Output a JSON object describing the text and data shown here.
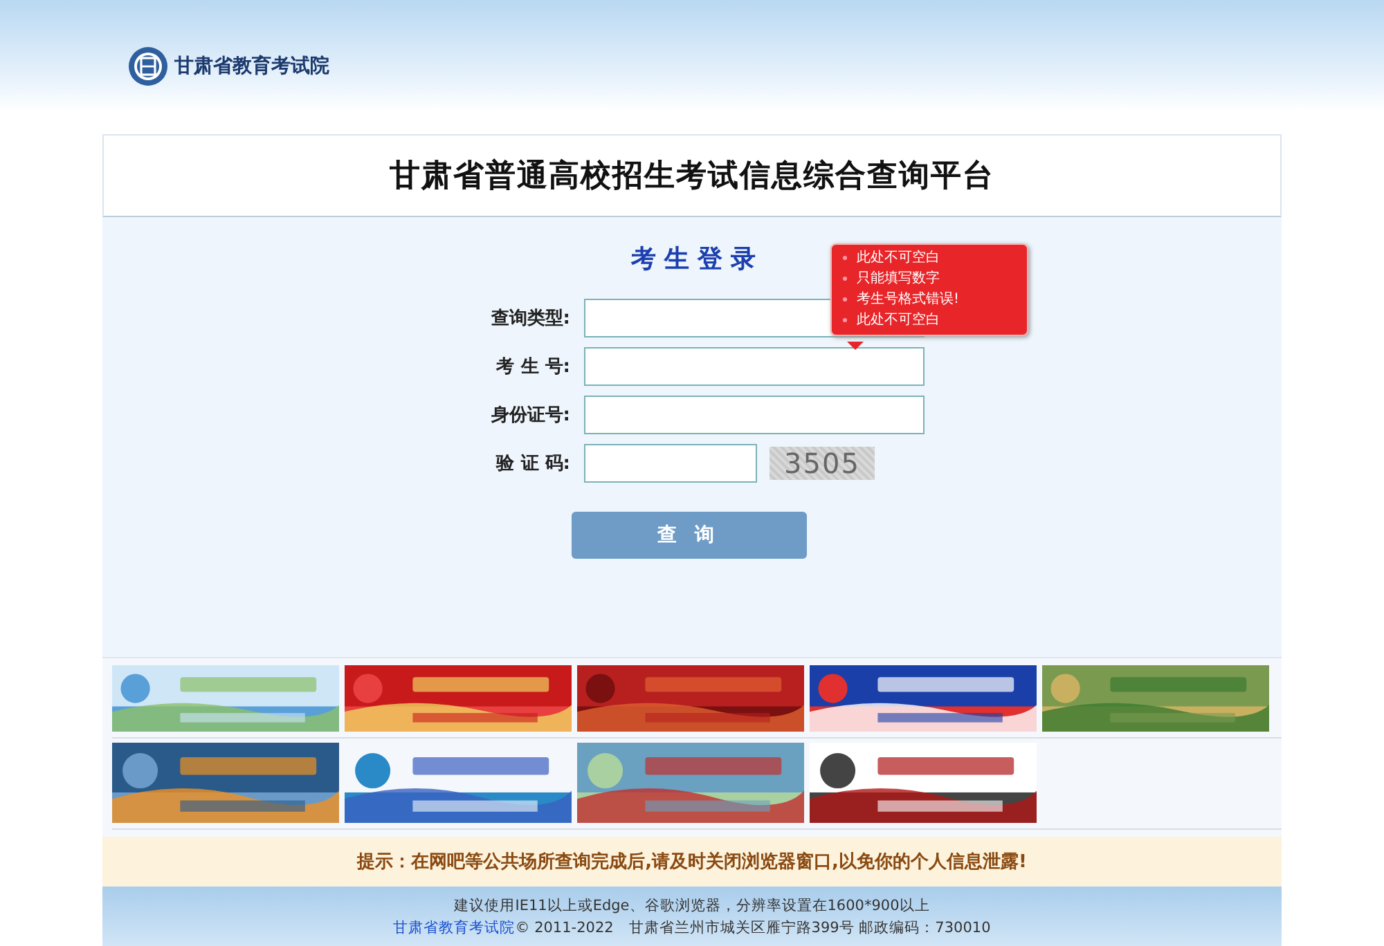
{
  "header": {
    "logo_text": "甘肃省教育考试院"
  },
  "platform_title": "甘肃省普通高校招生考试信息综合查询平台",
  "login": {
    "title": "考生登录",
    "fields": [
      {
        "label": "查询类型:",
        "kind": "text"
      },
      {
        "label": "考 生 号:",
        "kind": "text"
      },
      {
        "label": "身份证号:",
        "kind": "text"
      },
      {
        "label": "验 证 码:",
        "kind": "captcha",
        "captcha": "3505"
      }
    ],
    "submit": "查 询",
    "error_tooltip": [
      "此处不可空白",
      "只能填写数字",
      "考生号格式错误!",
      "此处不可空白"
    ]
  },
  "notice": "提示：在网吧等公共场所查询完成后,请及时关闭浏览器窗口,以免你的个人信息泄露!",
  "footer": {
    "browser_hint": "建议使用IE11以上或Edge、谷歌浏览器，分辨率设置在1600*900以上",
    "link": "甘肃省教育考试院",
    "copyright": "© 2011-2022　甘肃省兰州市城关区雁宁路399号 邮政编码：730010"
  }
}
